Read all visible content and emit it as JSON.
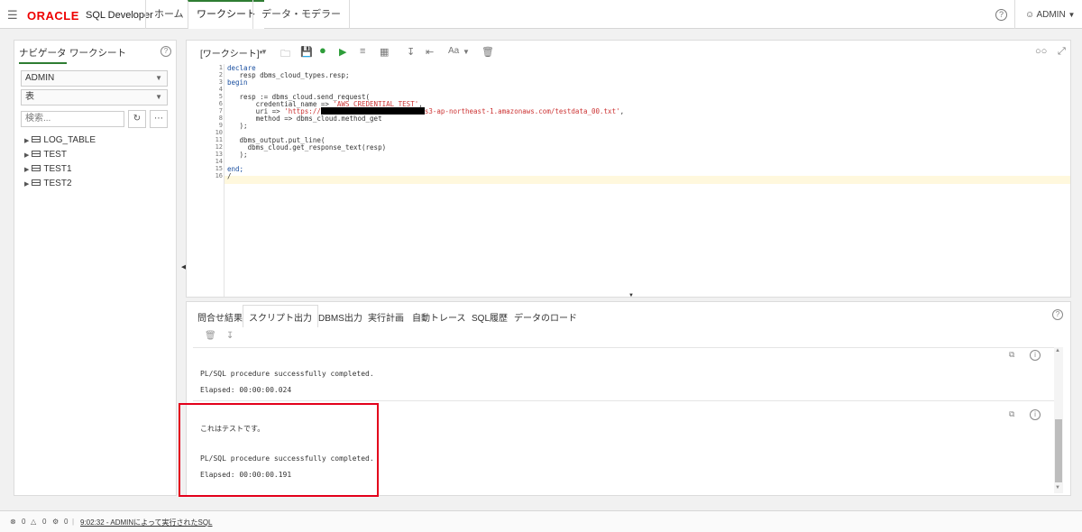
{
  "header": {
    "logo": "ORACLE",
    "product": "SQL Developer",
    "tabs": [
      "ホーム",
      "ワークシート",
      "データ・モデラー"
    ],
    "active_tab": "ワークシート",
    "user": "ADMIN",
    "help": "?"
  },
  "navigator": {
    "tabs": [
      "ナビゲータ",
      "ワークシート"
    ],
    "schema": "ADMIN",
    "object_type": "表",
    "search_placeholder": "検索...",
    "tables": [
      "LOG_TABLE",
      "TEST",
      "TEST1",
      "TEST2"
    ]
  },
  "editor": {
    "tab_label": "[ワークシート]*",
    "font_label": "Aa",
    "line_numbers": [
      "1",
      "2",
      "3",
      "4",
      "5",
      "6",
      "7",
      "8",
      "9",
      "10",
      "11",
      "12",
      "13",
      "14",
      "15",
      "16"
    ],
    "code": {
      "l1": "declare",
      "l2": "   resp dbms_cloud_types.resp;",
      "l3": "begin",
      "l5": "   resp := dbms_cloud.send_request(",
      "l6a": "       credential_name => ",
      "l6b": "'AWS_CREDENTIAL_TEST'",
      "l6c": ",",
      "l7a": "       uri => ",
      "l7b": "'https://",
      "l7c": "s3-ap-northeast-1.amazonaws.com/testdata_00.txt'",
      "l7d": ",",
      "l8": "       method => dbms_cloud.method_get",
      "l9": "   );",
      "l11": "   dbms_output.put_line(",
      "l12": "     dbms_cloud.get_response_text(resp)",
      "l13": "   );",
      "l15": "end;",
      "l16": "/"
    }
  },
  "output": {
    "tabs": [
      "問合せ結果",
      "スクリプト出力",
      "DBMS出力",
      "実行計画",
      "自動トレース",
      "SQL履歴",
      "データのロード"
    ],
    "active_tab": "スクリプト出力",
    "block1": {
      "line1": "PL/SQL procedure successfully completed.",
      "line2": "Elapsed: 00:00:00.024"
    },
    "block2": {
      "line0": "これはテストです。",
      "line1": "PL/SQL procedure successfully completed.",
      "line2": "Elapsed: 00:00:00.191"
    }
  },
  "statusbar": {
    "errors": "0",
    "warnings": "0",
    "tasks": "0",
    "message": "9:02:32 - ADMINによって実行されたSQL"
  },
  "colors": {
    "accent": "#2e7d32",
    "highlight": "#e3001b",
    "oracle_red": "#e00000"
  }
}
